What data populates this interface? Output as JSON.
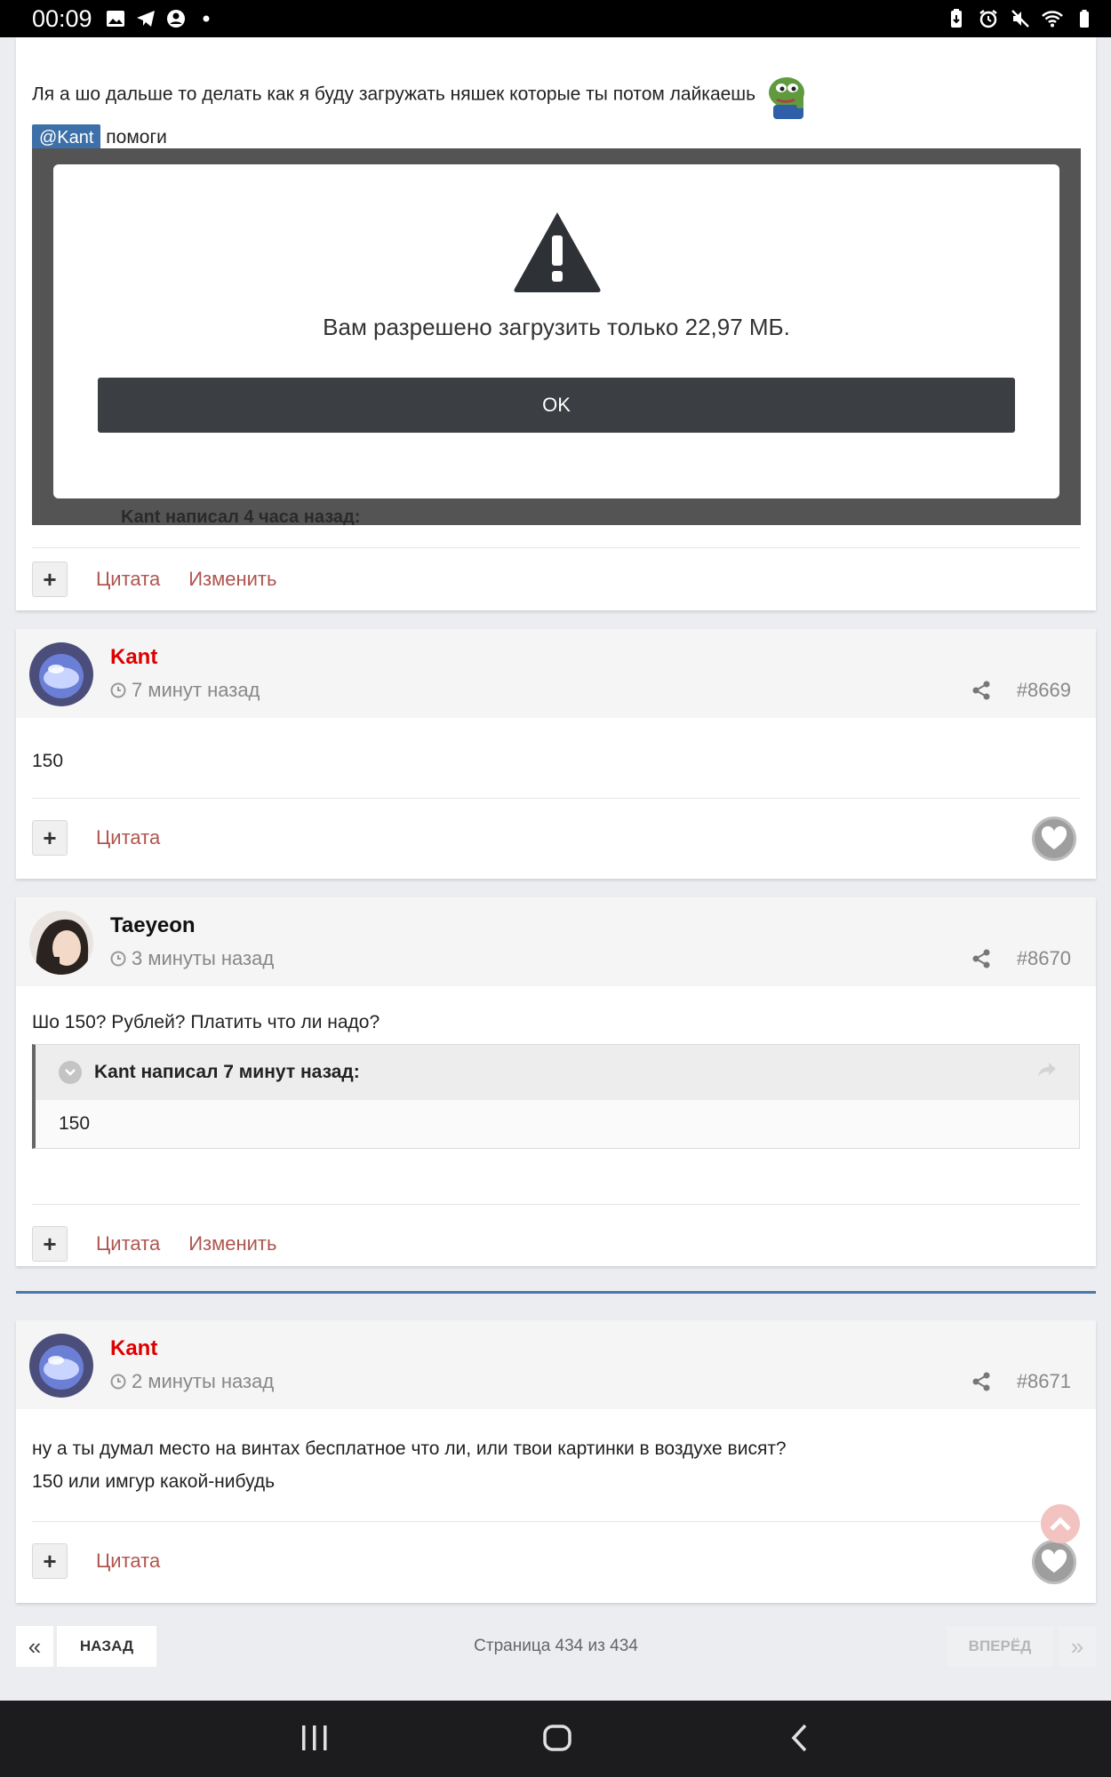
{
  "status_bar": {
    "time": "00:09"
  },
  "post_top": {
    "text": "Ля а шо дальше то делать как я буду загружать няшек которые ты потом лайкаешь",
    "mention": "@Kant",
    "mention_after": "помоги",
    "dialog": {
      "message": "Вам разрешено загрузить только 22,97 МБ.",
      "ok_label": "OK"
    },
    "behind_quote": "Kant написал 4 часа назад:",
    "quote_label": "Цитата",
    "edit_label": "Изменить"
  },
  "posts": [
    {
      "author": "Kant",
      "time": "7 минут назад",
      "number": "#8669",
      "body": [
        "150"
      ],
      "quote_label": "Цитата"
    },
    {
      "author": "Taeyeon",
      "time": "3 минуты назад",
      "number": "#8670",
      "body": [
        "Шо 150? Рублей? Платить что ли надо?"
      ],
      "quote": {
        "header": "Kant написал 7 минут назад:",
        "text": "150"
      },
      "quote_label": "Цитата",
      "edit_label": "Изменить"
    },
    {
      "author": "Kant",
      "time": "2 минуты назад",
      "number": "#8671",
      "body": [
        "ну а ты думал место на винтах бесплатное что ли, или твои картинки в воздухе висят?",
        "150 или имгур какой-нибудь"
      ],
      "quote_label": "Цитата"
    }
  ],
  "pagination": {
    "first": "«",
    "back": "НАЗАД",
    "info": "Страница 434 из 434",
    "next": "ВПЕРЁД",
    "last": "»"
  },
  "colors": {
    "accent_red": "#dd0000",
    "link": "#b0544e",
    "mention_bg": "#3d6fa8",
    "dialog_button": "#3b3e42"
  }
}
